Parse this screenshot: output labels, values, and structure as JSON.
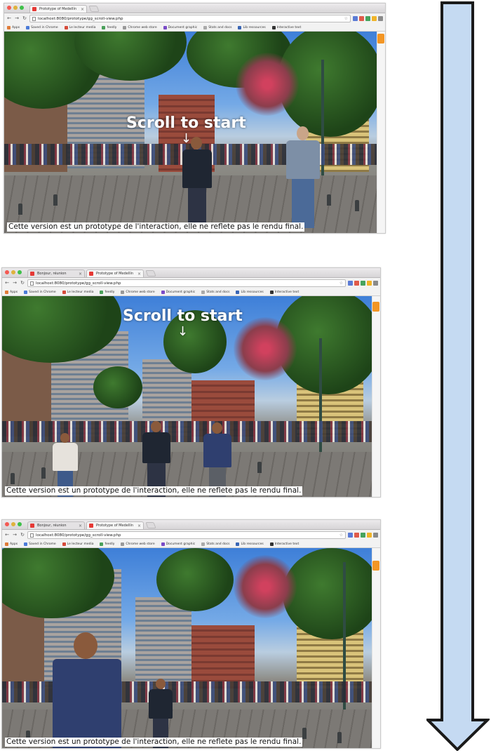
{
  "screens": [
    {
      "tabs": [
        {
          "label": "Prototype of Medellín"
        }
      ],
      "url": "localhost:8080/prototype/gg_scroll-view.php",
      "bookmarks": [
        "Apps",
        "Saved in Chrome",
        "Le lecteur media",
        "feedly",
        "Chrome web store",
        "Document graphic",
        "Stats and docs",
        "Lib ressources",
        "Interactive text"
      ],
      "hint": "Scroll to start",
      "caption": "Cette version est un prototype de l'interaction, elle ne reflete pas le rendu final."
    },
    {
      "tabs": [
        {
          "label": "Bonjour, réunion"
        },
        {
          "label": "Prototype of Medellín"
        }
      ],
      "url": "localhost:8080/prototype/gg_scroll-view.php",
      "bookmarks": [
        "Apps",
        "Saved in Chrome",
        "Le lecteur media",
        "feedly",
        "Chrome web store",
        "Document graphic",
        "Stats and docs",
        "Lib ressources",
        "Interactive text"
      ],
      "hint": "Scroll to start",
      "caption": "Cette version est un prototype de l'interaction, elle ne reflete pas le rendu final."
    },
    {
      "tabs": [
        {
          "label": "Bonjour, réunion"
        },
        {
          "label": "Prototype of Medellín"
        }
      ],
      "url": "localhost:8080/prototype/gg_scroll-view.php",
      "bookmarks": [
        "Apps",
        "Saved in Chrome",
        "Le lecteur media",
        "feedly",
        "Chrome web store",
        "Document graphic",
        "Stats and docs",
        "Lib ressources",
        "Interactive text"
      ],
      "caption": "Cette version est un prototype de l'interaction, elle ne reflete pas le rendu final."
    }
  ],
  "colors": {
    "scroll_thumb": "#f39625",
    "arrow_fill": "#c5daf2",
    "arrow_stroke": "#1a1a1a",
    "caption_bg": "#ffffff"
  },
  "icons": [
    "back-arrow-icon",
    "forward-arrow-icon",
    "reload-icon",
    "page-icon",
    "star-icon",
    "scroll-down-arrow-icon",
    "big-down-arrow-icon"
  ]
}
